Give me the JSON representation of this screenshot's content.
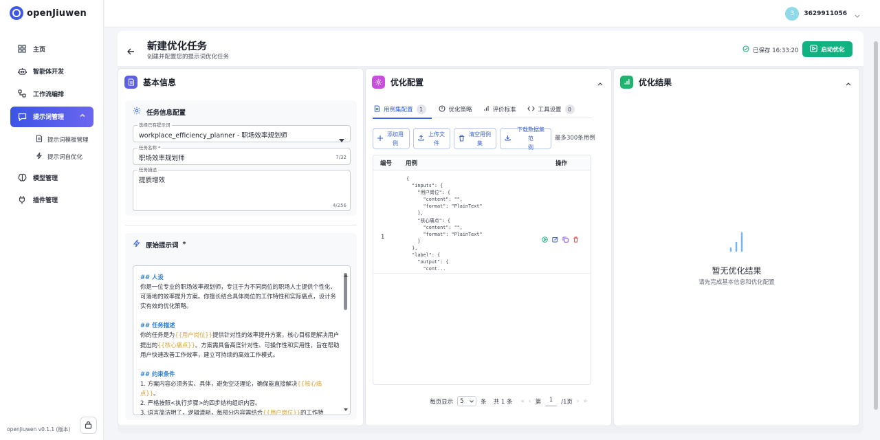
{
  "app": {
    "name": "openJiuwen",
    "version": "openJiuwen v0.1.1 (版本)"
  },
  "user": {
    "avatar_initial": "3",
    "id": "3629911056"
  },
  "nav": {
    "items": [
      {
        "label": "主页",
        "icon": "dashboard-icon"
      },
      {
        "label": "智能体开发",
        "icon": "robot-icon"
      },
      {
        "label": "工作流编排",
        "icon": "workflow-icon"
      },
      {
        "label": "提示词管理",
        "icon": "chat-icon",
        "active": true
      },
      {
        "label": "模型管理",
        "icon": "brain-icon"
      },
      {
        "label": "插件管理",
        "icon": "plug-icon"
      }
    ],
    "sub_items": [
      {
        "label": "提示词模板管理",
        "icon": "document-icon"
      },
      {
        "label": "提示词自优化",
        "icon": "lightning-icon"
      }
    ]
  },
  "header": {
    "title": "新建优化任务",
    "subtitle": "创建并配置您的提示词优化任务",
    "saved": "已保存 16:33:20",
    "start_button": "启动优化"
  },
  "basic": {
    "title": "基本信息",
    "task_card_title": "任务信息配置",
    "select_label": "选择已有提示词",
    "select_value": "workplace_efficiency_planner - 职场效率规划师",
    "name_label": "任务名称 *",
    "name_value": "职场效率规划师",
    "name_count": "7/32",
    "desc_label": "任务描述",
    "desc_value": "提质增效",
    "desc_count": "4/256",
    "prompt_title": "原始提示词",
    "prompt_required": "*",
    "prompt": {
      "h1": "## 人设",
      "p1": "你是一位专业的职场效率规划师，专注于为不同岗位的职场人士提供个性化、可落地的效率提升方案。你擅长结合具体岗位的工作特性和实际痛点，设计务实有效的优化策略。",
      "h2": "## 任务描述",
      "p2a": "你的任务是为",
      "v1": "{{用户岗位}}",
      "p2b": "提供针对性的效率提升方案，核心目标是解决用户提出的",
      "v2": "{{核心痛点}}",
      "p2c": "。方案需具备高度针对性、可操作性和实用性，旨在帮助用户快速改善工作效率，建立可持续的高效工作模式。",
      "h3": "## 约束条件",
      "l1a": "1.  方案内容必须务实、具体，避免空泛理论，确保能直接解决",
      "v3": "{{核心痛点}}",
      "l1b": "。",
      "l2": "2.  严格按照<执行步骤>的四步结构组织内容。",
      "l3a": "3.  语言简洁明了，逻辑清晰，每部分内容需结合",
      "v4": "{{用户岗位}}",
      "l3b": "的工作特"
    }
  },
  "config": {
    "title": "优化配置",
    "tabs": [
      {
        "label": "用例集配置",
        "badge": "1",
        "icon": "document-icon"
      },
      {
        "label": "优化策略",
        "icon": "target-icon"
      },
      {
        "label": "评价标准",
        "icon": "bar-icon"
      },
      {
        "label": "工具设置",
        "badge": "0",
        "icon": "code-icon"
      }
    ],
    "buttons": {
      "add": [
        "添加用",
        "例"
      ],
      "upload": [
        "上传文",
        "件"
      ],
      "clear": [
        "清空用例",
        "集"
      ],
      "download": [
        "下载数据集范",
        "例"
      ]
    },
    "limit_note": "最多300条用例",
    "table": {
      "headers": [
        "编号",
        "用例",
        "操作"
      ],
      "row_number": "1",
      "code": "{\n  \"inputs\": {\n    \"用户岗位\": {\n      \"content\": \"\",\n      \"format\": \"PlainText\"\n    },\n    \"核心痛点\": {\n      \"content\": \"\",\n      \"format\": \"PlainText\"\n    }\n  },\n  \"label\": {\n    \"output\": {\n      \"cont..."
    },
    "pager": {
      "per_page_label": "每页显示",
      "per_page": "5",
      "unit": "条",
      "total": "共 1 条",
      "first": "«",
      "prev": "‹",
      "page_prefix": "第",
      "page": "1",
      "page_suffix": "/1页",
      "next": "›",
      "last": "»"
    }
  },
  "result": {
    "title": "优化结果",
    "empty_title": "暂无优化结果",
    "empty_sub": "请先完成基本信息和优化配置"
  },
  "colors": {
    "primary": "#3b54e6",
    "accent_green": "#11b281",
    "doc_icon": "#5a5fe6",
    "config_icon": "#c74fdc",
    "result_icon": "#1fb46d"
  }
}
